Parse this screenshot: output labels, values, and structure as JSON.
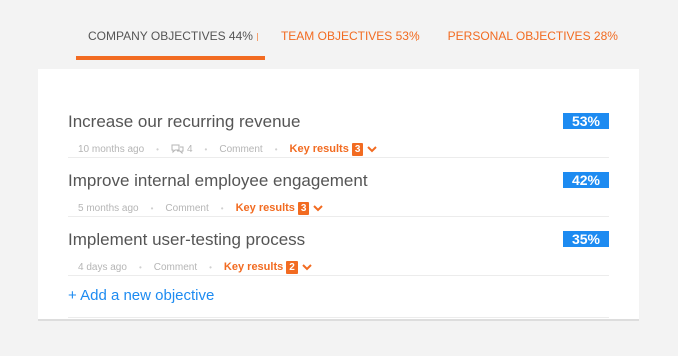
{
  "tabs": [
    {
      "label": "COMPANY OBJECTIVES 44%"
    },
    {
      "label": "TEAM OBJECTIVES 53%"
    },
    {
      "label": "PERSONAL OBJECTIVES 28%"
    }
  ],
  "colors": {
    "accent": "#f26b21",
    "progress": "#1d8bf1"
  },
  "objectives": [
    {
      "title": "Increase our recurring revenue",
      "percent": "53%",
      "age": "10 months ago",
      "comment_count": "4",
      "comment_label": "Comment",
      "key_results_label": "Key results",
      "key_results_count": "3"
    },
    {
      "title": "Improve internal employee engagement",
      "percent": "42%",
      "age": "5 months ago",
      "comment_label": "Comment",
      "key_results_label": "Key results",
      "key_results_count": "3"
    },
    {
      "title": "Implement user-testing process",
      "percent": "35%",
      "age": "4 days ago",
      "comment_label": "Comment",
      "key_results_label": "Key results",
      "key_results_count": "2"
    }
  ],
  "add_objective_label": "+ Add a new objective",
  "icons": {
    "comment": "comment-bubbles-icon",
    "expand": "chevron-down-icon"
  }
}
